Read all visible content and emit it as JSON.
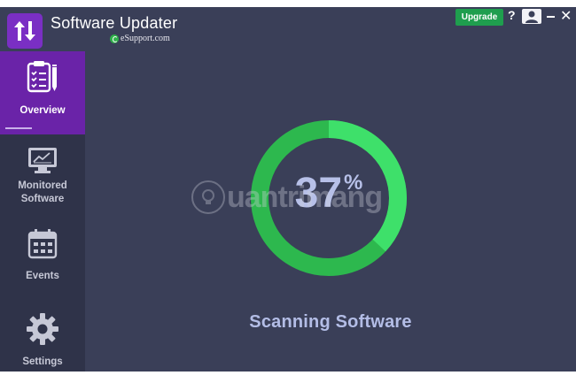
{
  "app": {
    "title": "Software Updater",
    "subtitle": "eSupport.com"
  },
  "titlebar": {
    "upgrade_label": "Upgrade",
    "help_label": "?",
    "close_label": "✕"
  },
  "sidebar": {
    "items": [
      {
        "label": "Overview",
        "icon": "clipboard-checklist-icon",
        "active": true
      },
      {
        "label": "Monitored Software",
        "icon": "monitor-chart-icon",
        "active": false
      },
      {
        "label": "Events",
        "icon": "calendar-icon",
        "active": false
      },
      {
        "label": "Settings",
        "icon": "gear-icon",
        "active": false
      }
    ]
  },
  "main": {
    "progress_percent": 37,
    "progress_number": "37",
    "progress_sign": "%",
    "status": "Scanning Software"
  },
  "watermark": {
    "text": "uantrimang",
    "icon": "lightbulb-icon"
  },
  "colors": {
    "background": "#3a3f58",
    "sidebar": "#2f3349",
    "accent_purple": "#6a23a8",
    "ring_filled": "#3ee06a",
    "ring_track": "#2db84e",
    "upgrade_green": "#1f9e4e"
  }
}
